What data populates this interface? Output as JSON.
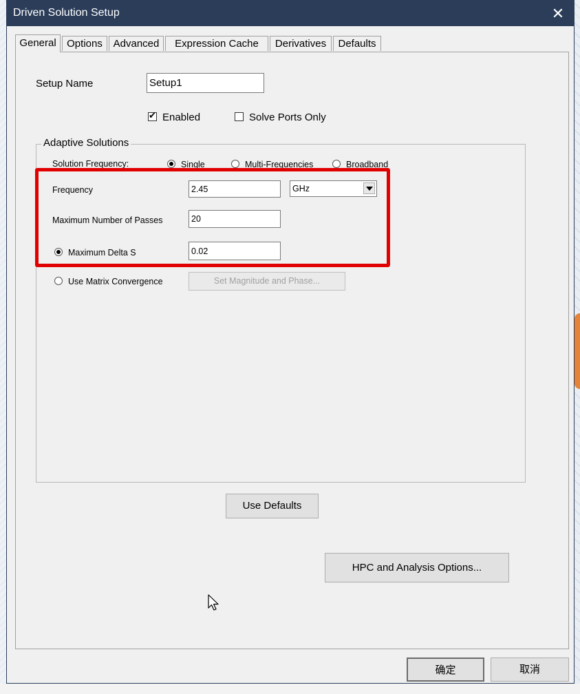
{
  "window": {
    "title": "Driven Solution Setup",
    "close_label": "✕"
  },
  "tabs": [
    {
      "label": "General"
    },
    {
      "label": "Options"
    },
    {
      "label": "Advanced"
    },
    {
      "label": "Expression Cache"
    },
    {
      "label": "Derivatives"
    },
    {
      "label": "Defaults"
    }
  ],
  "setup": {
    "name_label": "Setup Name",
    "name_value": "Setup1",
    "enabled_label": "Enabled",
    "enabled_checked": true,
    "solve_ports_label": "Solve Ports Only",
    "solve_ports_checked": false
  },
  "adaptive": {
    "group_title": "Adaptive Solutions",
    "solution_frequency_label": "Solution Frequency:",
    "mode_options": [
      "Single",
      "Multi-Frequencies",
      "Broadband"
    ],
    "mode_selected": "Single",
    "frequency_label": "Frequency",
    "frequency_value": "2.45",
    "frequency_unit": "GHz",
    "max_passes_label": "Maximum Number of Passes",
    "max_passes_value": "20",
    "max_delta_label": "Maximum Delta S",
    "max_delta_value": "0.02",
    "matrix_conv_label": "Use Matrix Convergence",
    "set_mag_phase_label": "Set Magnitude and Phase..."
  },
  "buttons": {
    "use_defaults": "Use Defaults",
    "hpc_options": "HPC and Analysis Options...",
    "ok": "确定",
    "cancel": "取消"
  },
  "colors": {
    "titlebar": "#2b3d59",
    "highlight": "#e00000",
    "dialog_bg": "#f0f0f0"
  }
}
